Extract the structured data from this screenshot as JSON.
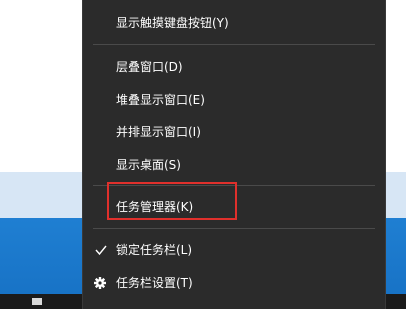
{
  "menu": {
    "items": [
      {
        "label": "显示触摸键盘按钮(Y)"
      },
      {
        "label": "层叠窗口(D)"
      },
      {
        "label": "堆叠显示窗口(E)"
      },
      {
        "label": "并排显示窗口(I)"
      },
      {
        "label": "显示桌面(S)"
      },
      {
        "label": "任务管理器(K)"
      },
      {
        "label": "锁定任务栏(L)",
        "icon": "checkmark-icon"
      },
      {
        "label": "任务栏设置(T)",
        "icon": "gear-icon"
      }
    ]
  },
  "colors": {
    "menu_bg": "#2b2b2b",
    "highlight_border": "#e0302c",
    "desktop_blue": "#1f7fd2"
  }
}
